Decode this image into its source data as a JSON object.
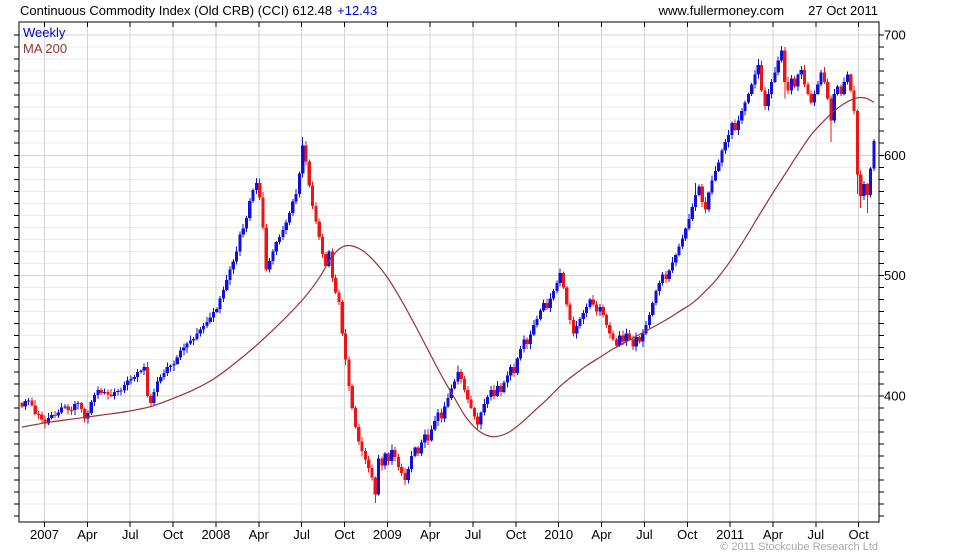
{
  "header": {
    "title": "Continuous Commodity Index (Old CRB) (CCI) 612.48",
    "change": "+12.43",
    "site": "www.fullermoney.com",
    "date": "27 Oct 2011"
  },
  "legend": {
    "weekly": "Weekly",
    "ma": "MA 200"
  },
  "footer": {
    "copyright": "© 2011 Stockcube Research Ltd"
  },
  "colors": {
    "up": "#0f0fe0",
    "down": "#ee1414",
    "ma": "#993333",
    "grid_major": "#d4d4d4",
    "grid_minor": "#ebebeb",
    "axis": "#000000",
    "change_text": "#0000cc",
    "copyright_text": "#a8a8a8"
  },
  "chart_data": {
    "type": "candlestick",
    "title": "Continuous Commodity Index (Old CRB) (CCI)",
    "last_close": 612.48,
    "last_change": 12.43,
    "x_axis": {
      "labels": [
        "2007",
        "Apr",
        "Jul",
        "Oct",
        "2008",
        "Apr",
        "Jul",
        "Oct",
        "2009",
        "Apr",
        "Jul",
        "Oct",
        "2010",
        "Apr",
        "Jul",
        "Oct",
        "2011",
        "Apr",
        "Jul",
        "Oct"
      ],
      "weeks_total": 259,
      "grid": "quarterly"
    },
    "y_axis": {
      "ticks": [
        400,
        500,
        600,
        700
      ],
      "minor_step": 10,
      "range": [
        295,
        710
      ],
      "side": "right"
    },
    "series": [
      {
        "name": "Weekly",
        "type": "candlestick",
        "close_anchors": [
          [
            0,
            391
          ],
          [
            2,
            396
          ],
          [
            4,
            385
          ],
          [
            7,
            377
          ],
          [
            9,
            384
          ],
          [
            11,
            386
          ],
          [
            13,
            391
          ],
          [
            15,
            388
          ],
          [
            17,
            394
          ],
          [
            19,
            381
          ],
          [
            21,
            395
          ],
          [
            23,
            405
          ],
          [
            25,
            403
          ],
          [
            27,
            400
          ],
          [
            29,
            404
          ],
          [
            31,
            409
          ],
          [
            33,
            414
          ],
          [
            35,
            420
          ],
          [
            37,
            424
          ],
          [
            38,
            400
          ],
          [
            39,
            394
          ],
          [
            41,
            412
          ],
          [
            43,
            419
          ],
          [
            45,
            425
          ],
          [
            47,
            432
          ],
          [
            49,
            440
          ],
          [
            51,
            446
          ],
          [
            53,
            452
          ],
          [
            55,
            458
          ],
          [
            57,
            465
          ],
          [
            59,
            472
          ],
          [
            61,
            488
          ],
          [
            63,
            505
          ],
          [
            65,
            520
          ],
          [
            66,
            534
          ],
          [
            68,
            548
          ],
          [
            69,
            562
          ],
          [
            70,
            571
          ],
          [
            71,
            577
          ],
          [
            72,
            565
          ],
          [
            73,
            540
          ],
          [
            74,
            505
          ],
          [
            75,
            512
          ],
          [
            76,
            520
          ],
          [
            77,
            528
          ],
          [
            79,
            538
          ],
          [
            81,
            552
          ],
          [
            83,
            568
          ],
          [
            84,
            585
          ],
          [
            85,
            608
          ],
          [
            86,
            595
          ],
          [
            87,
            575
          ],
          [
            88,
            558
          ],
          [
            89,
            545
          ],
          [
            90,
            532
          ],
          [
            91,
            518
          ],
          [
            92,
            508
          ],
          [
            93,
            520
          ],
          [
            94,
            498
          ],
          [
            95,
            486
          ],
          [
            96,
            478
          ],
          [
            97,
            452
          ],
          [
            98,
            430
          ],
          [
            99,
            408
          ],
          [
            100,
            390
          ],
          [
            101,
            374
          ],
          [
            102,
            362
          ],
          [
            103,
            354
          ],
          [
            104,
            347
          ],
          [
            105,
            340
          ],
          [
            106,
            332
          ],
          [
            107,
            318
          ],
          [
            108,
            348
          ],
          [
            109,
            342
          ],
          [
            110,
            352
          ],
          [
            111,
            346
          ],
          [
            112,
            355
          ],
          [
            113,
            349
          ],
          [
            114,
            341
          ],
          [
            115,
            336
          ],
          [
            116,
            330
          ],
          [
            117,
            339
          ],
          [
            118,
            350
          ],
          [
            119,
            357
          ],
          [
            120,
            352
          ],
          [
            121,
            361
          ],
          [
            122,
            368
          ],
          [
            123,
            363
          ],
          [
            124,
            372
          ],
          [
            125,
            379
          ],
          [
            126,
            386
          ],
          [
            127,
            381
          ],
          [
            128,
            391
          ],
          [
            129,
            398
          ],
          [
            130,
            406
          ],
          [
            131,
            412
          ],
          [
            132,
            420
          ],
          [
            133,
            414
          ],
          [
            134,
            405
          ],
          [
            135,
            397
          ],
          [
            136,
            390
          ],
          [
            137,
            383
          ],
          [
            138,
            376
          ],
          [
            139,
            386
          ],
          [
            140,
            393
          ],
          [
            141,
            399
          ],
          [
            142,
            405
          ],
          [
            143,
            400
          ],
          [
            144,
            408
          ],
          [
            145,
            403
          ],
          [
            146,
            411
          ],
          [
            147,
            417
          ],
          [
            148,
            424
          ],
          [
            149,
            419
          ],
          [
            150,
            431
          ],
          [
            151,
            439
          ],
          [
            152,
            447
          ],
          [
            153,
            443
          ],
          [
            154,
            451
          ],
          [
            155,
            459
          ],
          [
            156,
            464
          ],
          [
            157,
            471
          ],
          [
            158,
            477
          ],
          [
            159,
            473
          ],
          [
            160,
            481
          ],
          [
            161,
            487
          ],
          [
            162,
            494
          ],
          [
            163,
            502
          ],
          [
            164,
            490
          ],
          [
            165,
            476
          ],
          [
            166,
            463
          ],
          [
            167,
            452
          ],
          [
            168,
            458
          ],
          [
            169,
            464
          ],
          [
            170,
            469
          ],
          [
            171,
            474
          ],
          [
            172,
            480
          ],
          [
            173,
            476
          ],
          [
            174,
            470
          ],
          [
            175,
            474
          ],
          [
            176,
            467
          ],
          [
            177,
            459
          ],
          [
            178,
            452
          ],
          [
            179,
            447
          ],
          [
            180,
            442
          ],
          [
            181,
            450
          ],
          [
            182,
            445
          ],
          [
            183,
            452
          ],
          [
            184,
            447
          ],
          [
            185,
            441
          ],
          [
            186,
            449
          ],
          [
            187,
            445
          ],
          [
            188,
            452
          ],
          [
            189,
            459
          ],
          [
            190,
            467
          ],
          [
            191,
            477
          ],
          [
            192,
            487
          ],
          [
            193,
            494
          ],
          [
            194,
            501
          ],
          [
            195,
            497
          ],
          [
            196,
            504
          ],
          [
            197,
            511
          ],
          [
            198,
            517
          ],
          [
            199,
            524
          ],
          [
            200,
            531
          ],
          [
            201,
            539
          ],
          [
            202,
            547
          ],
          [
            203,
            557
          ],
          [
            204,
            567
          ],
          [
            205,
            574
          ],
          [
            206,
            561
          ],
          [
            207,
            555
          ],
          [
            208,
            569
          ],
          [
            209,
            579
          ],
          [
            210,
            587
          ],
          [
            211,
            594
          ],
          [
            212,
            604
          ],
          [
            213,
            611
          ],
          [
            214,
            617
          ],
          [
            215,
            627
          ],
          [
            216,
            621
          ],
          [
            217,
            629
          ],
          [
            218,
            637
          ],
          [
            219,
            644
          ],
          [
            220,
            651
          ],
          [
            221,
            659
          ],
          [
            222,
            667
          ],
          [
            223,
            675
          ],
          [
            224,
            654
          ],
          [
            225,
            641
          ],
          [
            226,
            651
          ],
          [
            227,
            661
          ],
          [
            228,
            669
          ],
          [
            229,
            679
          ],
          [
            230,
            687
          ],
          [
            231,
            661
          ],
          [
            232,
            654
          ],
          [
            233,
            664
          ],
          [
            234,
            657
          ],
          [
            235,
            667
          ],
          [
            236,
            671
          ],
          [
            237,
            659
          ],
          [
            238,
            651
          ],
          [
            239,
            644
          ],
          [
            240,
            651
          ],
          [
            241,
            659
          ],
          [
            242,
            669
          ],
          [
            243,
            661
          ],
          [
            244,
            647
          ],
          [
            245,
            629
          ],
          [
            246,
            651
          ],
          [
            247,
            657
          ],
          [
            248,
            651
          ],
          [
            249,
            661
          ],
          [
            250,
            667
          ],
          [
            251,
            654
          ],
          [
            252,
            637
          ],
          [
            253,
            584
          ],
          [
            254,
            566
          ],
          [
            255,
            576
          ],
          [
            256,
            567
          ],
          [
            257,
            589
          ],
          [
            258,
            612
          ]
        ],
        "extremes": {
          "71": {
            "high": 581
          },
          "85": {
            "high": 615
          },
          "107": {
            "low": 311
          },
          "116": {
            "low": 326
          },
          "132": {
            "high": 425
          },
          "138": {
            "low": 372
          },
          "163": {
            "high": 506
          },
          "204": {
            "high": 577
          },
          "223": {
            "high": 680
          },
          "230": {
            "high": 691
          },
          "231": {
            "low": 647
          },
          "245": {
            "low": 611
          },
          "253": {
            "low": 568
          },
          "254": {
            "low": 556
          },
          "256": {
            "low": 552
          }
        }
      },
      {
        "name": "MA 200",
        "type": "line",
        "points": [
          [
            0,
            374
          ],
          [
            8,
            378
          ],
          [
            16,
            381
          ],
          [
            24,
            384
          ],
          [
            32,
            387
          ],
          [
            39,
            391
          ],
          [
            45,
            397
          ],
          [
            52,
            405
          ],
          [
            58,
            414
          ],
          [
            64,
            426
          ],
          [
            71,
            442
          ],
          [
            78,
            460
          ],
          [
            85,
            480
          ],
          [
            90,
            498
          ],
          [
            93,
            512
          ],
          [
            96,
            522
          ],
          [
            99,
            525
          ],
          [
            103,
            521
          ],
          [
            107,
            511
          ],
          [
            111,
            497
          ],
          [
            115,
            479
          ],
          [
            119,
            459
          ],
          [
            123,
            438
          ],
          [
            127,
            417
          ],
          [
            131,
            398
          ],
          [
            134,
            384
          ],
          [
            137,
            374
          ],
          [
            140,
            368
          ],
          [
            143,
            366
          ],
          [
            147,
            369
          ],
          [
            151,
            377
          ],
          [
            155,
            387
          ],
          [
            159,
            397
          ],
          [
            163,
            408
          ],
          [
            167,
            417
          ],
          [
            171,
            425
          ],
          [
            175,
            432
          ],
          [
            179,
            439
          ],
          [
            183,
            445
          ],
          [
            187,
            451
          ],
          [
            191,
            457
          ],
          [
            195,
            463
          ],
          [
            199,
            470
          ],
          [
            203,
            477
          ],
          [
            207,
            487
          ],
          [
            211,
            499
          ],
          [
            215,
            514
          ],
          [
            219,
            531
          ],
          [
            223,
            549
          ],
          [
            227,
            567
          ],
          [
            231,
            584
          ],
          [
            235,
            601
          ],
          [
            239,
            617
          ],
          [
            243,
            629
          ],
          [
            246,
            637
          ],
          [
            249,
            643
          ],
          [
            252,
            647
          ],
          [
            254,
            648
          ],
          [
            256,
            647
          ],
          [
            258,
            644
          ]
        ]
      }
    ]
  }
}
